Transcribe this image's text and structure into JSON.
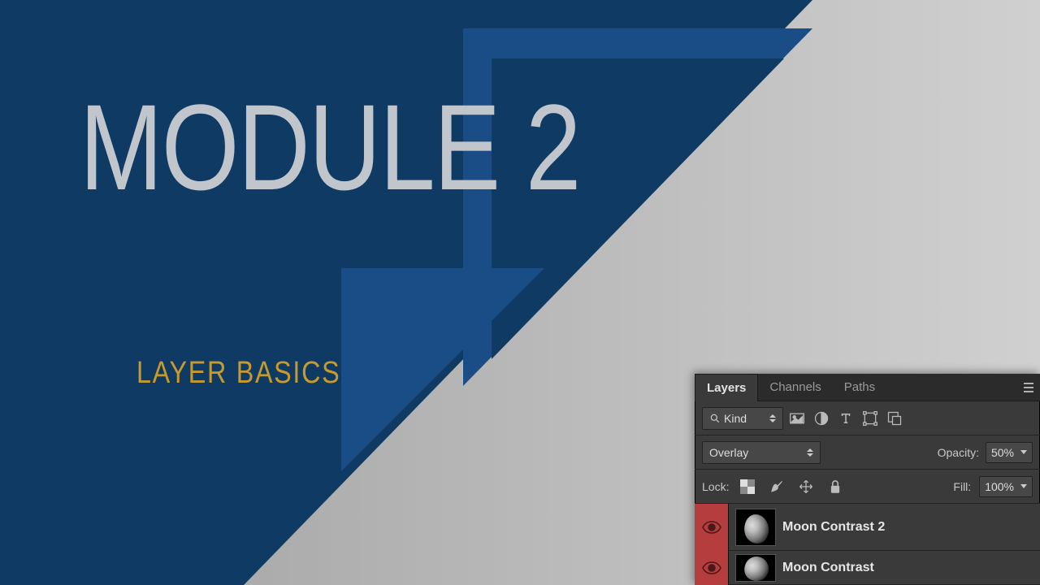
{
  "slide": {
    "title": "MODULE 2",
    "subtitle": "LAYER BASICS"
  },
  "panel": {
    "tabs": [
      "Layers",
      "Channels",
      "Paths"
    ],
    "active_tab": 0,
    "filter_label": "Kind",
    "blend_mode": "Overlay",
    "opacity_label": "Opacity:",
    "opacity_value": "50%",
    "lock_label": "Lock:",
    "fill_label": "Fill:",
    "fill_value": "100%",
    "layers": [
      {
        "name": "Moon Contrast 2",
        "visible": true
      },
      {
        "name": "Moon Contrast",
        "visible": true
      }
    ]
  }
}
